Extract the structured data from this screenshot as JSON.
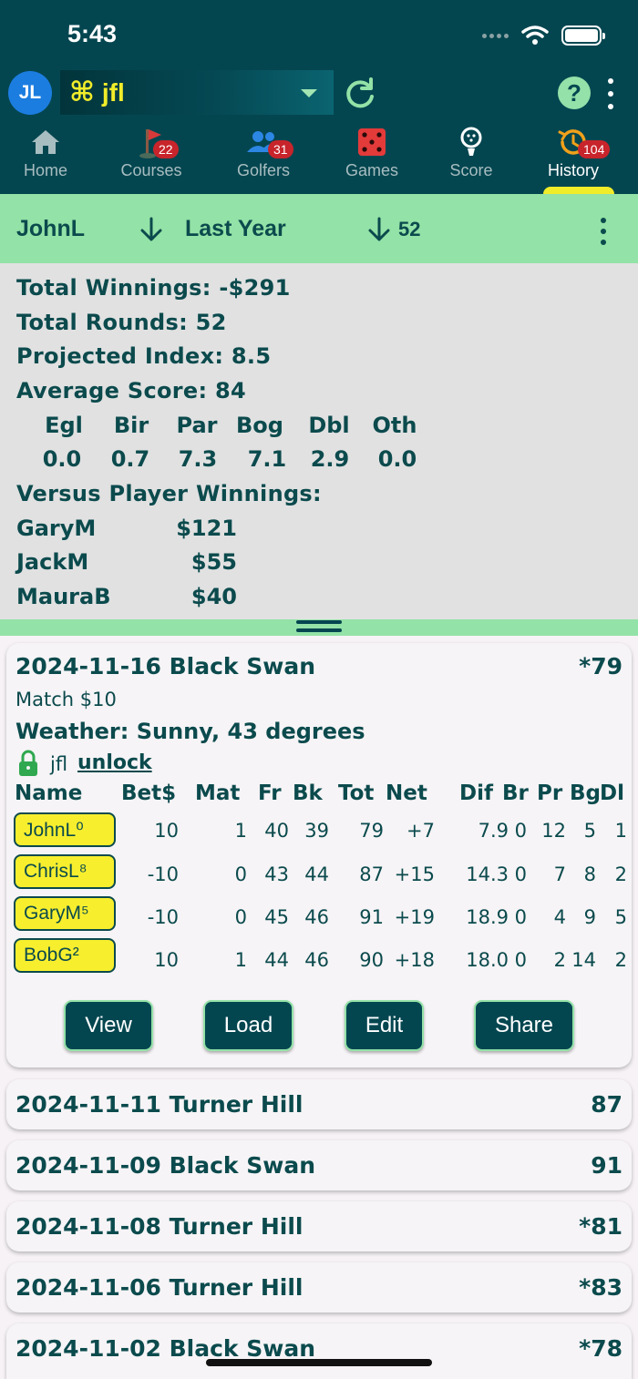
{
  "status": {
    "time": "5:43"
  },
  "header": {
    "avatar_initials": "JL",
    "group_symbol": "⌘",
    "group_name": "jfl",
    "help_label": "?"
  },
  "tabs": [
    {
      "label": "Home",
      "badge": "",
      "icon": "home-icon"
    },
    {
      "label": "Courses",
      "badge": "22",
      "icon": "flag-icon"
    },
    {
      "label": "Golfers",
      "badge": "31",
      "icon": "users-icon"
    },
    {
      "label": "Games",
      "badge": "",
      "icon": "dice-icon"
    },
    {
      "label": "Score",
      "badge": "",
      "icon": "golf-ball-icon"
    },
    {
      "label": "History",
      "badge": "104",
      "icon": "history-icon"
    }
  ],
  "filter": {
    "player": "JohnL",
    "period": "Last Year",
    "count": "52"
  },
  "summary": {
    "total_winnings": "Total Winnings: -$291",
    "total_rounds": "Total Rounds: 52",
    "projected_index": "Projected Index: 8.5",
    "average_score": "Average Score: 84",
    "stat_headers": [
      "Egl",
      "Bir",
      "Par",
      "Bog",
      "Dbl",
      "Oth"
    ],
    "stat_values": [
      "0.0",
      "0.7",
      "7.3",
      "7.1",
      "2.9",
      "0.0"
    ],
    "versus_title": "Versus Player Winnings:",
    "versus": [
      {
        "name": "GaryM",
        "amount": "$121"
      },
      {
        "name": "JackM",
        "amount": "$55"
      },
      {
        "name": "MauraB",
        "amount": "$40"
      }
    ]
  },
  "expanded_round": {
    "title": "2024-11-16 Black Swan",
    "score": "*79",
    "match": "Match $10",
    "weather": "Weather: Sunny, 43 degrees",
    "owner": "jfl",
    "unlock_label": "unlock",
    "columns": [
      "Name",
      "Bet$",
      "Mat",
      "Fr",
      "Bk",
      "Tot",
      "Net",
      "Dif",
      "Br",
      "Pr",
      "Bg",
      "Dl"
    ],
    "rows": [
      {
        "name": "JohnL⁰",
        "cells": [
          "10",
          "1",
          "40",
          "39",
          "79",
          "+7",
          "7.9",
          "0",
          "12",
          "5",
          "1"
        ]
      },
      {
        "name": "ChrisL⁸",
        "cells": [
          "-10",
          "0",
          "43",
          "44",
          "87",
          "+15",
          "14.3",
          "0",
          "7",
          "8",
          "2"
        ]
      },
      {
        "name": "GaryM⁵",
        "cells": [
          "-10",
          "0",
          "45",
          "46",
          "91",
          "+19",
          "18.9",
          "0",
          "4",
          "9",
          "5"
        ]
      },
      {
        "name": "BobG²",
        "cells": [
          "10",
          "1",
          "44",
          "46",
          "90",
          "+18",
          "18.0",
          "0",
          "2",
          "14",
          "2"
        ]
      }
    ],
    "buttons": {
      "view": "View",
      "load": "Load",
      "edit": "Edit",
      "share": "Share"
    }
  },
  "rounds": [
    {
      "title": "2024-11-11 Turner Hill",
      "score": "87"
    },
    {
      "title": "2024-11-09 Black Swan",
      "score": "91"
    },
    {
      "title": "2024-11-08 Turner Hill",
      "score": "*81"
    },
    {
      "title": "2024-11-06 Turner Hill",
      "score": "*83"
    },
    {
      "title": "2024-11-02 Black Swan",
      "score": "*78"
    }
  ],
  "colors": {
    "header": "#044650",
    "accent_green": "#93e2a7",
    "chip_yellow": "#f7ef2e",
    "badge_red": "#c8242b",
    "lock_green": "#2fa84f"
  }
}
